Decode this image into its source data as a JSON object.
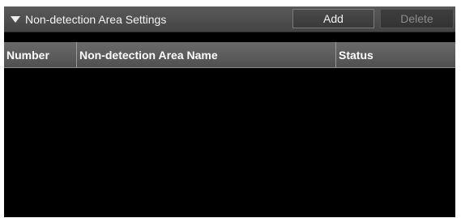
{
  "section": {
    "title": "Non-detection Area Settings",
    "toggle_icon": "triangle-down-icon",
    "add_label": "Add",
    "delete_label": "Delete"
  },
  "table": {
    "columns": [
      "Number",
      "Non-detection Area Name",
      "Status"
    ],
    "rows": []
  },
  "colors": {
    "header_bg": "#4f4f4f",
    "table_bg": "#000000",
    "disabled_text": "#8c8c8c"
  }
}
